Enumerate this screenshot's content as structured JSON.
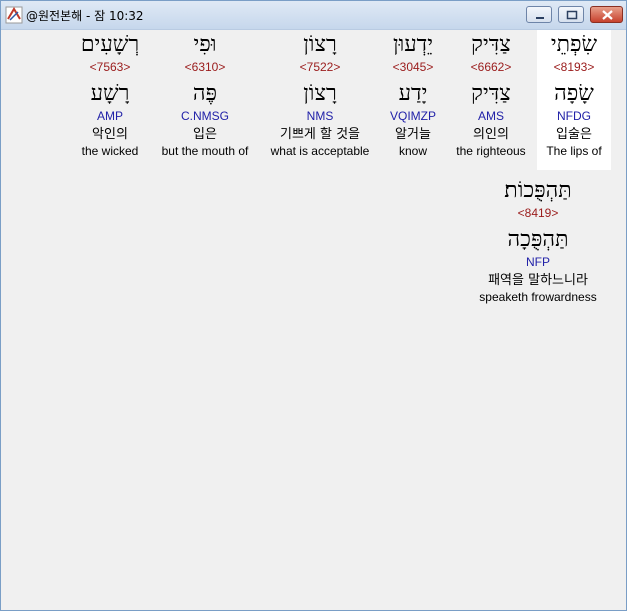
{
  "window": {
    "title": "@원전본해 - 잠 10:32",
    "minimize_icon": "minimize-icon",
    "maximize_icon": "maximize-icon",
    "close_icon": "close-icon",
    "app_icon": "app-icon"
  },
  "words": [
    {
      "hebrew": "שִׂפְתֵי",
      "strong": "<8193>",
      "lemma": "שָׂפָה",
      "morph": "NFDG",
      "korean": "입술은",
      "english": "The lips of",
      "highlighted": true
    },
    {
      "hebrew": "צַדִּיק",
      "strong": "<6662>",
      "lemma": "צַדִּיק",
      "morph": "AMS",
      "korean": "의인의",
      "english": "the righteous"
    },
    {
      "hebrew": "יֵדְעוּן",
      "strong": "<3045>",
      "lemma": "יָדַע",
      "morph": "VQIMZP",
      "korean": "알거늘",
      "english": "know"
    },
    {
      "hebrew": "רָצוֹן",
      "strong": "<7522>",
      "lemma": "רָצוֹן",
      "morph": "NMS",
      "korean": "기쁘게 할 것을",
      "english": "what is acceptable"
    },
    {
      "hebrew": "וּפִי",
      "strong": "<6310>",
      "lemma": "פֶּה",
      "morph": "C.NMSG",
      "korean": "입은",
      "english": "but the mouth of"
    },
    {
      "hebrew": "רְשָׁעִים",
      "strong": "<7563>",
      "lemma": "רָשָׁע",
      "morph": "AMP",
      "korean": "악인의",
      "english": "the wicked"
    },
    {
      "hebrew": "תַּהְפֻּכוֹת׃",
      "strong": "<8419>",
      "lemma": "תַּהְפֻּכָה",
      "morph": "NFP",
      "korean": "패역을 말하느니라",
      "english": "speaketh frowardness"
    }
  ]
}
